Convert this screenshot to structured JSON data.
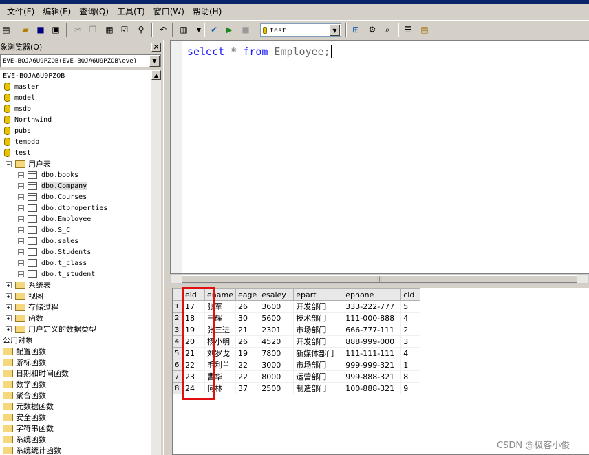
{
  "menu": [
    "文件(F)",
    "编辑(E)",
    "查询(Q)",
    "工具(T)",
    "窗口(W)",
    "帮助(H)"
  ],
  "toolbar": {
    "database": "test"
  },
  "explorer": {
    "title": "象浏览器(O)",
    "server_combo": "EVE-BOJA6U9PZOB(EVE-BOJA6U9PZOB\\eve)",
    "server": "EVE-BOJA6U9PZOB",
    "databases": [
      "master",
      "model",
      "msdb",
      "Northwind",
      "pubs",
      "tempdb",
      "test"
    ],
    "user_tables_label": "用户表",
    "tables": [
      "dbo.books",
      "dbo.Company",
      "dbo.Courses",
      "dbo.dtproperties",
      "dbo.Employee",
      "dbo.S_C",
      "dbo.sales",
      "dbo.Students",
      "dbo.t_class",
      "dbo.t_student"
    ],
    "selected_table": "dbo.Company",
    "other_folders": [
      "系统表",
      "视图",
      "存储过程",
      "函数",
      "用户定义的数据类型"
    ],
    "common_objects": "公用对象",
    "common_folders": [
      "配置函数",
      "游标函数",
      "日期和时间函数",
      "数学函数",
      "聚合函数",
      "元数据函数",
      "安全函数",
      "字符串函数",
      "系统函数",
      "系统统计函数"
    ]
  },
  "editor": {
    "kw1": "select",
    "star": " * ",
    "kw2": "from",
    "rest": " Employee;"
  },
  "results": {
    "columns": [
      "eid",
      "ename",
      "eage",
      "esaley",
      "epart",
      "ephone",
      "cid"
    ],
    "rows": [
      [
        "1",
        "17",
        "张军",
        "26",
        "3600",
        "开发部门",
        "333-222-777",
        "5"
      ],
      [
        "2",
        "18",
        "王辉",
        "30",
        "5600",
        "技术部门",
        "111-000-888",
        "4"
      ],
      [
        "3",
        "19",
        "张三进",
        "21",
        "2301",
        "市场部门",
        "666-777-111",
        "2"
      ],
      [
        "4",
        "20",
        "杨小明",
        "26",
        "4520",
        "开发部门",
        "888-999-000",
        "3"
      ],
      [
        "5",
        "21",
        "刘罗戈",
        "19",
        "7800",
        "新媒体部门",
        "111-111-111",
        "4"
      ],
      [
        "6",
        "22",
        "毛利兰",
        "22",
        "3000",
        "市场部门",
        "999-999-321",
        "1"
      ],
      [
        "7",
        "23",
        "曹华",
        "22",
        "8000",
        "运营部门",
        "999-888-321",
        "8"
      ],
      [
        "8",
        "24",
        "何林",
        "37",
        "2500",
        "制造部门",
        "100-888-321",
        "9"
      ]
    ]
  },
  "watermark": "CSDN @极客小俊"
}
